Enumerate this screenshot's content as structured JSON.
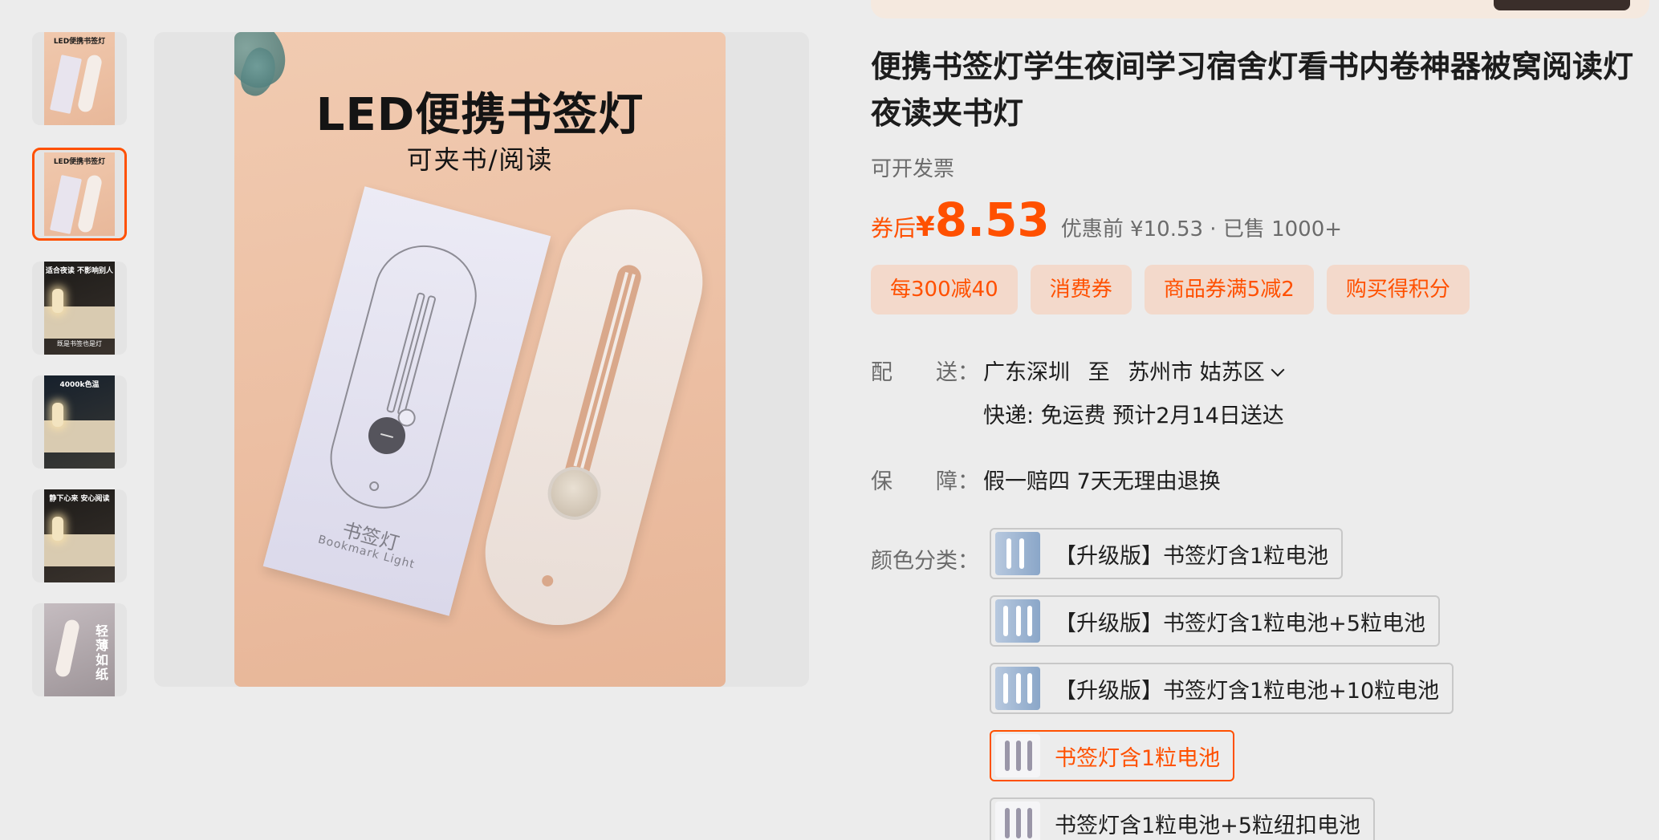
{
  "gallery": {
    "thumbnails": [
      {
        "title": "LED便携书签灯",
        "variant": "peach"
      },
      {
        "title": "LED便携书签灯",
        "variant": "peach",
        "selected": true
      },
      {
        "title": "适合夜读 不影响别人",
        "caption": "既是书签也是灯",
        "variant": "dark"
      },
      {
        "title": "4000k色温",
        "caption": "",
        "variant": "darkblue"
      },
      {
        "title": "静下心来 安心阅读",
        "caption": "",
        "variant": "dark"
      },
      {
        "title": "轻薄如纸",
        "variant": "grey"
      }
    ],
    "main_image": {
      "headline": "LED便携书签灯",
      "subline": "可夹书/阅读",
      "card_label_cn": "书签灯",
      "card_label_en": "Bookmark Light"
    }
  },
  "product": {
    "title": "便携书签灯学生夜间学习宿舍灯看书内卷神器被窝阅读灯夜读夹书灯",
    "invoice": "可开发票",
    "price": {
      "prefix": "券后",
      "symbol": "¥",
      "value": "8.53",
      "meta": "优惠前 ¥10.53 · 已售 1000+"
    },
    "promotions": [
      "每300减40",
      "消费券",
      "商品券满5减2",
      "购买得积分"
    ],
    "delivery": {
      "label": "配　　送：",
      "from": "广东深圳",
      "to_word": "至",
      "to": "苏州市 姑苏区",
      "shipping": "快递: 免运费  预计2月14日送达"
    },
    "guarantee": {
      "label": "保　　障：",
      "value": "假一赔四 7天无理由退换"
    },
    "color": {
      "label": "颜色分类：",
      "options": [
        {
          "label": "【升级版】书签灯含1粒电池",
          "selected": false
        },
        {
          "label": "【升级版】书签灯含1粒电池+5粒电池",
          "selected": false
        },
        {
          "label": "【升级版】书签灯含1粒电池+10粒电池",
          "selected": false
        },
        {
          "label": "书签灯含1粒电池",
          "selected": true
        },
        {
          "label": "书签灯含1粒电池+5粒纽扣电池",
          "selected": false
        }
      ]
    }
  },
  "colors": {
    "accent": "#ff5000",
    "promo_bg": "#f3d9cb",
    "page_bg": "#ececec"
  }
}
